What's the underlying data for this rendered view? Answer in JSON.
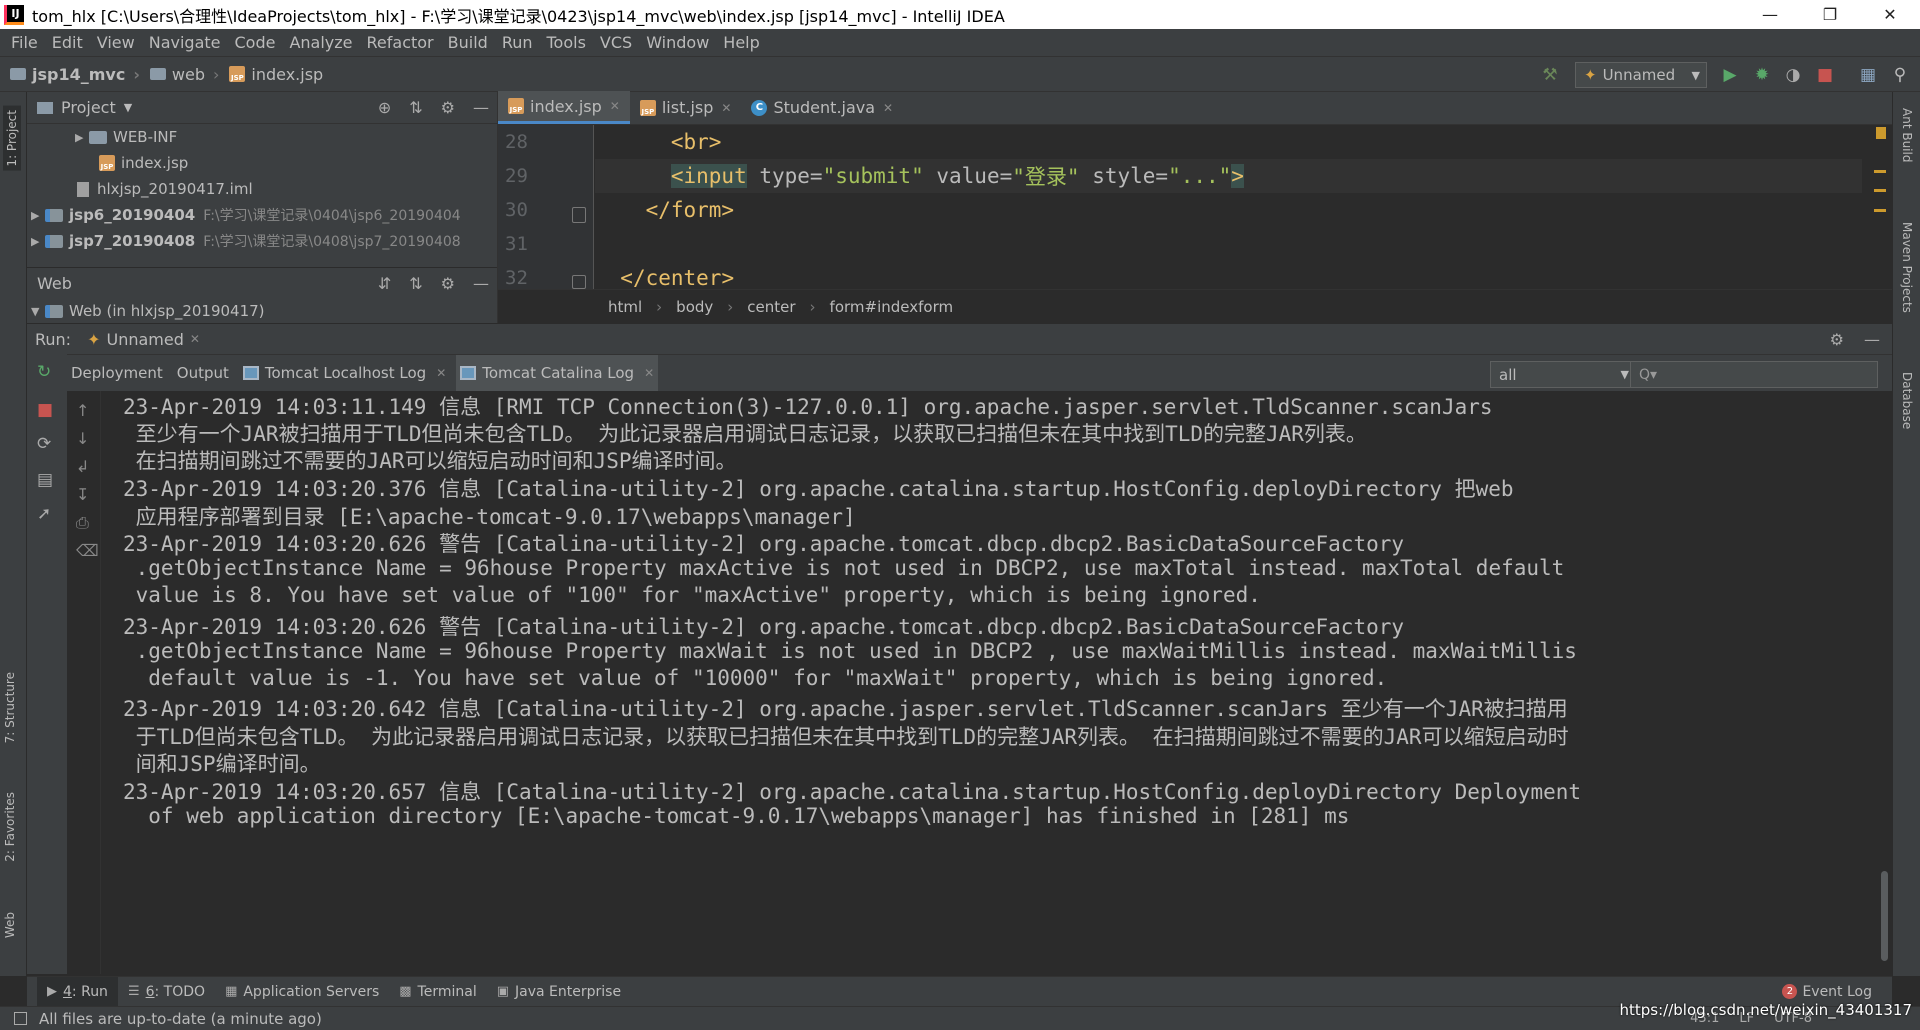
{
  "window": {
    "title": "tom_hlx [C:\\Users\\合理性\\IdeaProjects\\tom_hlx] - F:\\学习\\课堂记录\\0423\\jsp14_mvc\\web\\index.jsp [jsp14_mvc] - IntelliJ IDEA",
    "logo": "IJ"
  },
  "menu": [
    "File",
    "Edit",
    "View",
    "Navigate",
    "Code",
    "Analyze",
    "Refactor",
    "Build",
    "Run",
    "Tools",
    "VCS",
    "Window",
    "Help"
  ],
  "breadcrumbs": [
    "jsp14_mvc",
    "web",
    "index.jsp"
  ],
  "toolbar": {
    "run_config": "Unnamed"
  },
  "project_panel": {
    "title": "Project",
    "tree": [
      {
        "label": "WEB-INF",
        "path": ""
      },
      {
        "label": "index.jsp",
        "path": ""
      },
      {
        "label": "hlxjsp_20190417.iml",
        "path": ""
      },
      {
        "label": "jsp6_20190404",
        "path": "F:\\学习\\课堂记录\\0404\\jsp6_20190404"
      },
      {
        "label": "jsp7_20190408",
        "path": "F:\\学习\\课堂记录\\0408\\jsp7_20190408"
      }
    ]
  },
  "web_panel": {
    "title": "Web",
    "item": "Web (in hlxjsp_20190417)"
  },
  "editor": {
    "tabs": [
      "index.jsp",
      "list.jsp",
      "Student.java"
    ],
    "line_numbers": [
      "28",
      "29",
      "30",
      "31",
      "32"
    ],
    "lines": {
      "l28": {
        "indent": "      ",
        "tag": "<br>"
      },
      "l29": {
        "indent": "      ",
        "tag_open": "<input",
        "a1": " type=",
        "v1": "\"submit\"",
        "a2": " value=",
        "v2": "\"登录\"",
        "a3": " style=",
        "v3": "\"...\"",
        "tag_close": ">"
      },
      "l30": {
        "indent": "    ",
        "tag": "</form>"
      },
      "l32": {
        "indent": "  ",
        "tag": "</center>"
      }
    },
    "crumbs": [
      "html",
      "body",
      "center",
      "form#indexform"
    ]
  },
  "run": {
    "label": "Run:",
    "config_tab": "Unnamed",
    "tabs": [
      "Deployment",
      "Output",
      "Tomcat Localhost Log",
      "Tomcat Catalina Log"
    ],
    "filter": "all",
    "search_placeholder": "Q▾",
    "console": [
      "23-Apr-2019 14:03:11.149 信息 [RMI TCP Connection(3)-127.0.0.1] org.apache.jasper.servlet.TldScanner.scanJars",
      " 至少有一个JAR被扫描用于TLD但尚未包含TLD。 为此记录器启用调试日志记录，以获取已扫描但未在其中找到TLD的完整JAR列表。",
      " 在扫描期间跳过不需要的JAR可以缩短启动时间和JSP编译时间。",
      "23-Apr-2019 14:03:20.376 信息 [Catalina-utility-2] org.apache.catalina.startup.HostConfig.deployDirectory 把web",
      " 应用程序部署到目录 [E:\\apache-tomcat-9.0.17\\webapps\\manager]",
      "23-Apr-2019 14:03:20.626 警告 [Catalina-utility-2] org.apache.tomcat.dbcp.dbcp2.BasicDataSourceFactory",
      " .getObjectInstance Name = 96house Property maxActive is not used in DBCP2, use maxTotal instead. maxTotal default",
      " value is 8. You have set value of \"100\" for \"maxActive\" property, which is being ignored.",
      "23-Apr-2019 14:03:20.626 警告 [Catalina-utility-2] org.apache.tomcat.dbcp.dbcp2.BasicDataSourceFactory",
      " .getObjectInstance Name = 96house Property maxWait is not used in DBCP2 , use maxWaitMillis instead. maxWaitMillis",
      "  default value is -1. You have set value of \"10000\" for \"maxWait\" property, which is being ignored.",
      "23-Apr-2019 14:03:20.642 信息 [Catalina-utility-2] org.apache.jasper.servlet.TldScanner.scanJars 至少有一个JAR被扫描用",
      " 于TLD但尚未包含TLD。 为此记录器启用调试日志记录，以获取已扫描但未在其中找到TLD的完整JAR列表。 在扫描期间跳过不需要的JAR可以缩短启动时",
      " 间和JSP编译时间。",
      "23-Apr-2019 14:03:20.657 信息 [Catalina-utility-2] org.apache.catalina.startup.HostConfig.deployDirectory Deployment",
      "  of web application directory [E:\\apache-tomcat-9.0.17\\webapps\\manager] has finished in [281] ms"
    ]
  },
  "left_stripe": [
    "1: Project",
    "7: Structure",
    "2: Favorites",
    "Web"
  ],
  "right_stripe": [
    "Ant Build",
    "Maven Projects",
    "Database"
  ],
  "tool_windows": [
    {
      "num": "4",
      "label": ": Run"
    },
    {
      "num": "6",
      "label": ": TODO"
    },
    {
      "num": "",
      "label": "Application Servers"
    },
    {
      "num": "",
      "label": "Terminal"
    },
    {
      "num": "",
      "label": "Java Enterprise"
    }
  ],
  "event_log": {
    "count": "2",
    "label": "Event Log"
  },
  "status": {
    "message": "All files are up-to-date (a minute ago)",
    "position": "43:1",
    "line_sep": "LF",
    "encoding": "UTF-8"
  },
  "watermark": "https://blog.csdn.net/weixin_43401317"
}
